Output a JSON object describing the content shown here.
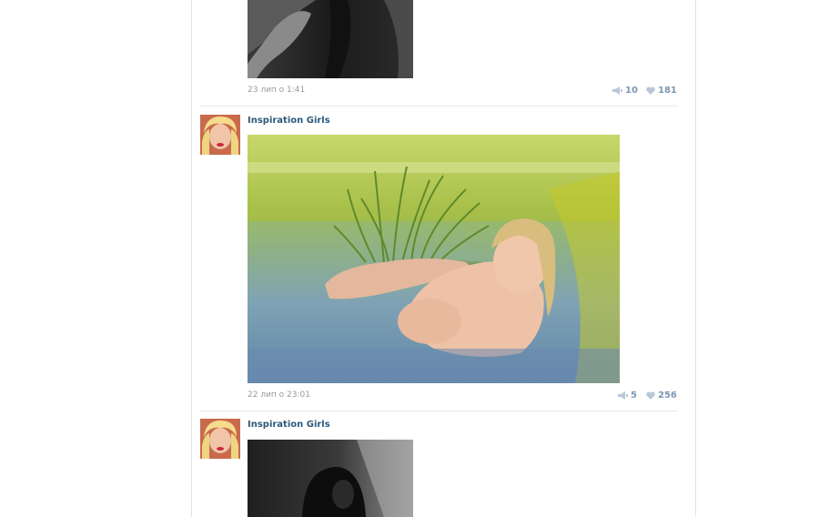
{
  "colors": {
    "link": "#2b587a",
    "meta": "#999999",
    "action": "#7d97b3"
  },
  "posts": [
    {
      "date": "23 лип о 1:41",
      "reposts": "10",
      "likes": "181",
      "photo": "grayscale photo"
    },
    {
      "author": "Inspiration Girls",
      "date": "22 лип о 23:01",
      "reposts": "5",
      "likes": "256",
      "photo": "color photo"
    },
    {
      "author": "Inspiration Girls",
      "photo": "grayscale photo"
    }
  ],
  "icons": {
    "repost": "megaphone-icon",
    "like": "heart-icon"
  }
}
